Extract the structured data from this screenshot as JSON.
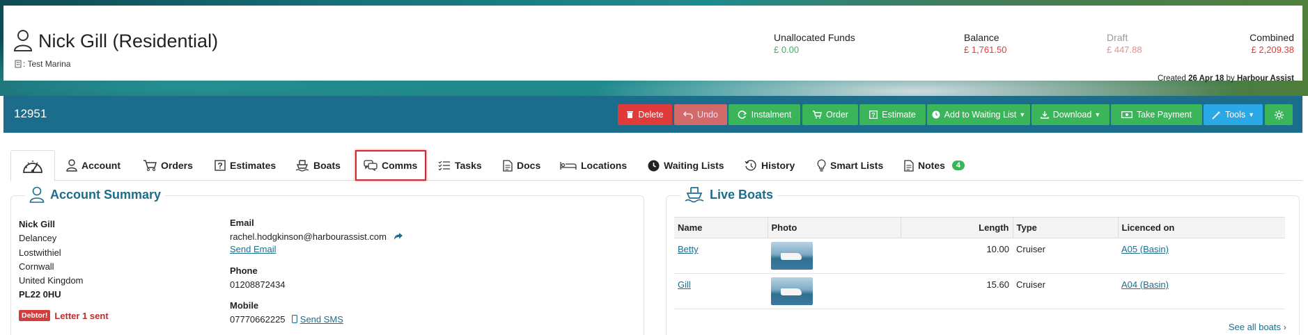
{
  "customer": {
    "name": "Nick Gill (Residential)",
    "marina_prefix": ": Test Marina"
  },
  "funds": {
    "unallocated_label": "Unallocated Funds",
    "unallocated_value": "£ 0.00",
    "balance_label": "Balance",
    "balance_value": "£ 1,761.50",
    "draft_label": "Draft",
    "draft_value": "£ 447.88",
    "combined_label": "Combined",
    "combined_value": "£ 2,209.38"
  },
  "created": {
    "prefix": "Created",
    "date": "26 Apr 18",
    "by": "by",
    "author": "Harbour Assist"
  },
  "account_number": "12951",
  "toolbar": {
    "delete": "Delete",
    "undo": "Undo",
    "instalment": "Instalment",
    "order": "Order",
    "estimate": "Estimate",
    "waiting_list": "Add to Waiting List",
    "download": "Download",
    "take_payment": "Take Payment",
    "tools": "Tools"
  },
  "tabs": {
    "account": "Account",
    "orders": "Orders",
    "estimates": "Estimates",
    "boats": "Boats",
    "comms": "Comms",
    "tasks": "Tasks",
    "docs": "Docs",
    "locations": "Locations",
    "waiting_lists": "Waiting Lists",
    "history": "History",
    "smart_lists": "Smart Lists",
    "notes": "Notes",
    "notes_count": "4"
  },
  "account_summary": {
    "title": "Account Summary",
    "address": {
      "name": "Nick Gill",
      "line1": "Delancey",
      "line2": "Lostwithiel",
      "line3": "Cornwall",
      "line4": "United Kingdom",
      "postcode": "PL22 0HU"
    },
    "debtor_badge": "Debtor!",
    "debtor_text": "Letter 1 sent",
    "email_label": "Email",
    "email": "rachel.hodgkinson@harbourassist.com",
    "send_email": "Send Email",
    "phone_label": "Phone",
    "phone": "01208872434",
    "mobile_label": "Mobile",
    "mobile": "07770662225",
    "send_sms": "Send SMS"
  },
  "live_boats": {
    "title": "Live Boats",
    "columns": [
      "Name",
      "Photo",
      "Length",
      "Type",
      "Licenced on"
    ],
    "rows": [
      {
        "name": "Betty",
        "length": "10.00",
        "type": "Cruiser",
        "licenced_on": "A05 (Basin)"
      },
      {
        "name": "Gill",
        "length": "15.60",
        "type": "Cruiser",
        "licenced_on": "A04 (Basin)"
      }
    ],
    "see_all": "See all boats"
  },
  "colors": {
    "brand": "#1c6d8b",
    "green": "#3ab55a",
    "red": "#e03b3b",
    "blue": "#2ba8e6"
  }
}
